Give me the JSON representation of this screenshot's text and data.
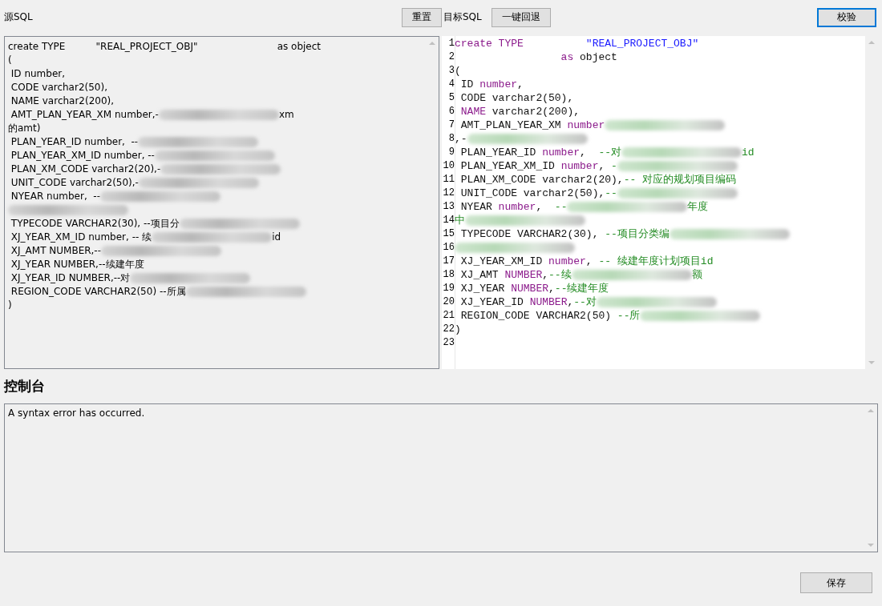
{
  "toolbar": {
    "source_label": "源SQL",
    "reset_button": {
      "label": "重置",
      "focused": false
    },
    "target_label": "目标SQL",
    "rollback_button": {
      "label": "一键回退",
      "focused": false
    },
    "validate_button": {
      "label": "校验",
      "focused": true
    }
  },
  "source_sql": {
    "lines": [
      [
        {
          "kind": "text",
          "text": "create TYPE          \"REAL_PROJECT_OBJ\"                          as object"
        }
      ],
      [
        {
          "kind": "text",
          "text": "("
        }
      ],
      [
        {
          "kind": "text",
          "text": " ID number,"
        }
      ],
      [
        {
          "kind": "text",
          "text": " CODE varchar2(50),"
        }
      ],
      [
        {
          "kind": "text",
          "text": " NAME varchar2(200),"
        }
      ],
      [
        {
          "kind": "text",
          "text": " AMT_PLAN_YEAR_XM number,-"
        },
        {
          "kind": "redacted"
        },
        {
          "kind": "text",
          "text": "xm"
        }
      ],
      [
        {
          "kind": "text",
          "text": "的amt)"
        }
      ],
      [
        {
          "kind": "text",
          "text": " PLAN_YEAR_ID number,  --"
        },
        {
          "kind": "redacted"
        }
      ],
      [
        {
          "kind": "text",
          "text": " PLAN_YEAR_XM_ID number, --"
        },
        {
          "kind": "redacted"
        }
      ],
      [
        {
          "kind": "text",
          "text": " PLAN_XM_CODE varchar2(20),-"
        },
        {
          "kind": "redacted"
        }
      ],
      [
        {
          "kind": "text",
          "text": " UNIT_CODE varchar2(50),-"
        },
        {
          "kind": "redacted"
        }
      ],
      [
        {
          "kind": "text",
          "text": " NYEAR number,  --"
        },
        {
          "kind": "redacted"
        }
      ],
      [
        {
          "kind": "redacted"
        }
      ],
      [
        {
          "kind": "text",
          "text": " TYPECODE VARCHAR2(30), --项目分"
        },
        {
          "kind": "redacted"
        }
      ],
      [
        {
          "kind": "text",
          "text": " XJ_YEAR_XM_ID number, -- 续"
        },
        {
          "kind": "redacted"
        },
        {
          "kind": "text",
          "text": "id"
        }
      ],
      [
        {
          "kind": "text",
          "text": " XJ_AMT NUMBER,--"
        },
        {
          "kind": "redacted"
        }
      ],
      [
        {
          "kind": "text",
          "text": " XJ_YEAR NUMBER,--续建年度"
        }
      ],
      [
        {
          "kind": "text",
          "text": " XJ_YEAR_ID NUMBER,--对"
        },
        {
          "kind": "redacted"
        }
      ],
      [
        {
          "kind": "text",
          "text": " REGION_CODE VARCHAR2(50) --所属"
        },
        {
          "kind": "redacted"
        }
      ],
      [
        {
          "kind": "text",
          "text": ")"
        }
      ]
    ]
  },
  "target_sql": {
    "lines": [
      {
        "number": "1",
        "segments": [
          {
            "kind": "keyword",
            "text": "create TYPE          "
          },
          {
            "kind": "string",
            "text": "\"REAL_PROJECT_OBJ\""
          }
        ]
      },
      {
        "number": "2",
        "segments": [
          {
            "kind": "keyword",
            "text": "                 as"
          },
          {
            "kind": "plain",
            "text": " object"
          }
        ]
      },
      {
        "number": "3",
        "segments": [
          {
            "kind": "plain",
            "text": "("
          }
        ]
      },
      {
        "number": "4",
        "segments": [
          {
            "kind": "plain",
            "text": " ID "
          },
          {
            "kind": "keyword",
            "text": "number"
          },
          {
            "kind": "plain",
            "text": ","
          }
        ]
      },
      {
        "number": "5",
        "segments": [
          {
            "kind": "plain",
            "text": " CODE varchar2(50),"
          }
        ]
      },
      {
        "number": "6",
        "segments": [
          {
            "kind": "keyword",
            "text": " NAME"
          },
          {
            "kind": "plain",
            "text": " varchar2(200),"
          }
        ]
      },
      {
        "number": "7",
        "segments": [
          {
            "kind": "plain",
            "text": " AMT_PLAN_YEAR_XM "
          },
          {
            "kind": "keyword",
            "text": "number"
          },
          {
            "kind": "redacted"
          }
        ]
      },
      {
        "number": "8",
        "segments": [
          {
            "kind": "plain",
            "text": ",-"
          },
          {
            "kind": "redacted"
          }
        ]
      },
      {
        "number": "9",
        "segments": [
          {
            "kind": "plain",
            "text": " PLAN_YEAR_ID "
          },
          {
            "kind": "keyword",
            "text": "number"
          },
          {
            "kind": "plain",
            "text": ",  "
          },
          {
            "kind": "comment",
            "text": "--对"
          },
          {
            "kind": "redacted"
          },
          {
            "kind": "comment",
            "text": "id"
          }
        ]
      },
      {
        "number": "10",
        "segments": [
          {
            "kind": "plain",
            "text": " PLAN_YEAR_XM_ID "
          },
          {
            "kind": "keyword",
            "text": "number"
          },
          {
            "kind": "plain",
            "text": ", "
          },
          {
            "kind": "comment",
            "text": "-"
          },
          {
            "kind": "redacted"
          }
        ]
      },
      {
        "number": "11",
        "segments": [
          {
            "kind": "plain",
            "text": " PLAN_XM_CODE varchar2(20),"
          },
          {
            "kind": "comment",
            "text": "-- 对应的规划项目编码"
          }
        ]
      },
      {
        "number": "12",
        "segments": [
          {
            "kind": "plain",
            "text": " UNIT_CODE varchar2(50),"
          },
          {
            "kind": "comment",
            "text": "--"
          },
          {
            "kind": "redacted"
          }
        ]
      },
      {
        "number": "13",
        "segments": [
          {
            "kind": "plain",
            "text": " NYEAR "
          },
          {
            "kind": "keyword",
            "text": "number"
          },
          {
            "kind": "plain",
            "text": ",  "
          },
          {
            "kind": "comment",
            "text": "--"
          },
          {
            "kind": "redacted"
          },
          {
            "kind": "comment",
            "text": "年度"
          }
        ]
      },
      {
        "number": "14",
        "segments": [
          {
            "kind": "comment",
            "text": "中"
          },
          {
            "kind": "redacted"
          }
        ]
      },
      {
        "number": "15",
        "segments": [
          {
            "kind": "plain",
            "text": " TYPECODE VARCHAR2(30), "
          },
          {
            "kind": "comment",
            "text": "--项目分类编"
          },
          {
            "kind": "redacted"
          }
        ]
      },
      {
        "number": "16",
        "segments": [
          {
            "kind": "redacted"
          }
        ]
      },
      {
        "number": "17",
        "segments": [
          {
            "kind": "plain",
            "text": " XJ_YEAR_XM_ID "
          },
          {
            "kind": "keyword",
            "text": "number"
          },
          {
            "kind": "plain",
            "text": ", "
          },
          {
            "kind": "comment",
            "text": "-- 续建年度计划项目id"
          }
        ]
      },
      {
        "number": "18",
        "segments": [
          {
            "kind": "plain",
            "text": " XJ_AMT "
          },
          {
            "kind": "keyword",
            "text": "NUMBER"
          },
          {
            "kind": "plain",
            "text": ","
          },
          {
            "kind": "comment",
            "text": "--续"
          },
          {
            "kind": "redacted"
          },
          {
            "kind": "comment",
            "text": "额"
          }
        ]
      },
      {
        "number": "19",
        "segments": [
          {
            "kind": "plain",
            "text": " XJ_YEAR "
          },
          {
            "kind": "keyword",
            "text": "NUMBER"
          },
          {
            "kind": "plain",
            "text": ","
          },
          {
            "kind": "comment",
            "text": "--续建年度"
          }
        ]
      },
      {
        "number": "20",
        "segments": [
          {
            "kind": "plain",
            "text": " XJ_YEAR_ID "
          },
          {
            "kind": "keyword",
            "text": "NUMBER"
          },
          {
            "kind": "plain",
            "text": ","
          },
          {
            "kind": "comment",
            "text": "--对"
          },
          {
            "kind": "redacted"
          }
        ]
      },
      {
        "number": "21",
        "segments": [
          {
            "kind": "plain",
            "text": " REGION_CODE VARCHAR2(50) "
          },
          {
            "kind": "comment",
            "text": "--所"
          },
          {
            "kind": "redacted"
          }
        ]
      },
      {
        "number": "22",
        "segments": [
          {
            "kind": "plain",
            "text": ")"
          }
        ]
      },
      {
        "number": "23"
      }
    ]
  },
  "console": {
    "title": "控制台",
    "output": "A syntax error has occurred."
  },
  "save_button": {
    "label": "保存",
    "focused": false
  }
}
